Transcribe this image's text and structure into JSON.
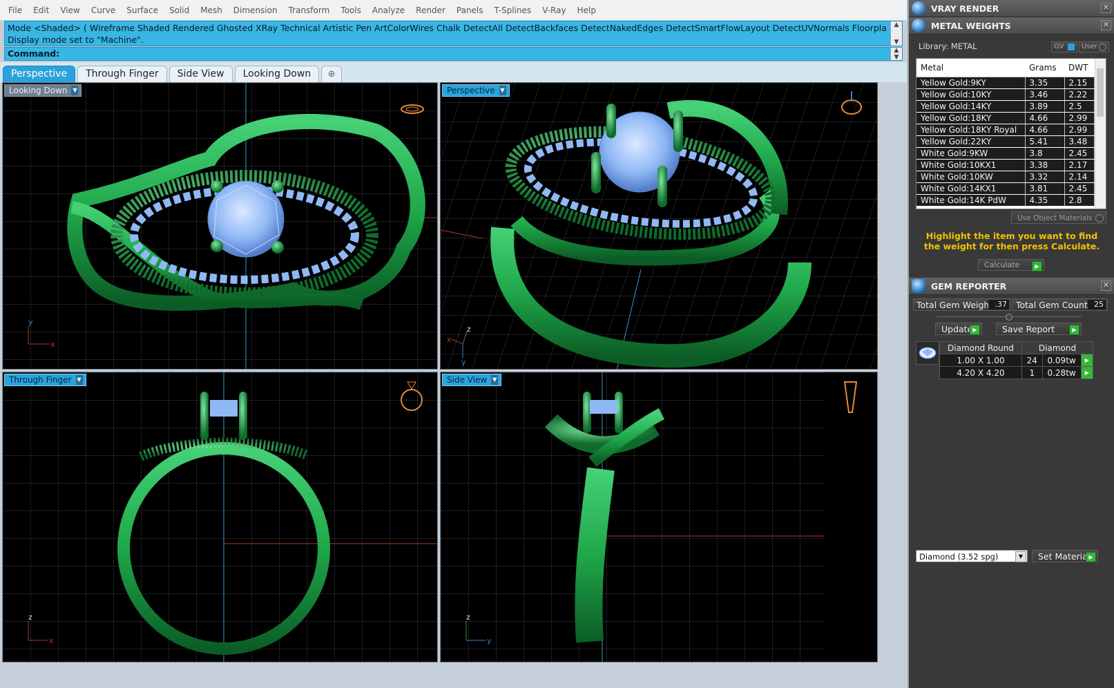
{
  "menu": [
    "File",
    "Edit",
    "View",
    "Curve",
    "Surface",
    "Solid",
    "Mesh",
    "Dimension",
    "Transform",
    "Tools",
    "Analyze",
    "Render",
    "Panels",
    "T-Splines",
    "V-Ray",
    "Help"
  ],
  "command": {
    "history_line1": "Mode <Shaded> ( Wireframe  Shaded  Rendered  Ghosted  XRay  Technical  Artistic  Pen  ArtColorWires  Chalk  DetectAll  DetectBackfaces  DetectNakedEdges  DetectSmartFlowLayout  DetectUVNormals  Floorplan  GV",
    "history_line2": "Display mode set to \"Machine\".",
    "prompt": "Command:"
  },
  "tabs": [
    {
      "label": "Perspective",
      "active": true
    },
    {
      "label": "Through Finger",
      "active": false
    },
    {
      "label": "Side View",
      "active": false
    },
    {
      "label": "Looking Down",
      "active": false
    }
  ],
  "tab_add_symbol": "⊕",
  "viewports": {
    "top_left": {
      "label": "Looking Down",
      "axes": [
        "y",
        "x"
      ]
    },
    "top_right": {
      "label": "Perspective",
      "axes": [
        "z",
        "x",
        "y"
      ]
    },
    "bottom_left": {
      "label": "Through Finger",
      "axes": [
        "z",
        "x"
      ]
    },
    "bottom_right": {
      "label": "Side View",
      "axes": [
        "z",
        "y"
      ]
    }
  },
  "colors": {
    "metal": "#1fa74a",
    "gem": "#8fb8f5",
    "grid": "#3a3a3a",
    "accent": "#2aa3dc",
    "go_button": "#35b63c",
    "calc_hint": "#f2c200"
  },
  "right_panel": {
    "vray_title": "VRAY RENDER",
    "metal_title": "METAL WEIGHTS",
    "library_label": "Library: METAL",
    "gv_label": "GV",
    "user_label": "User",
    "table_headers": [
      "Metal",
      "Grams",
      "DWT"
    ],
    "metals": [
      {
        "name": "Yellow Gold:9KY",
        "grams": "3.35",
        "dwt": "2.15"
      },
      {
        "name": "Yellow Gold:10KY",
        "grams": "3.46",
        "dwt": "2.22"
      },
      {
        "name": "Yellow Gold:14KY",
        "grams": "3.89",
        "dwt": "2.5"
      },
      {
        "name": "Yellow Gold:18KY",
        "grams": "4.66",
        "dwt": "2.99"
      },
      {
        "name": "Yellow Gold:18KY Royal",
        "grams": "4.66",
        "dwt": "2.99"
      },
      {
        "name": "Yellow Gold:22KY",
        "grams": "5.41",
        "dwt": "3.48"
      },
      {
        "name": "White Gold:9KW",
        "grams": "3.8",
        "dwt": "2.45"
      },
      {
        "name": "White Gold:10KX1",
        "grams": "3.38",
        "dwt": "2.17"
      },
      {
        "name": "White Gold:10KW",
        "grams": "3.32",
        "dwt": "2.14"
      },
      {
        "name": "White Gold:14KX1",
        "grams": "3.81",
        "dwt": "2.45"
      },
      {
        "name": "White Gold:14K PdW",
        "grams": "4.35",
        "dwt": "2.8"
      }
    ],
    "use_object_materials": "Use Object Materials",
    "calc_hint": "Highlight the item you want to find the weight for then press Calculate.",
    "calculate_label": "Calculate",
    "gem_title": "GEM REPORTER",
    "total_gem_weight_label": "Total Gem Weight",
    "total_gem_weight": ".37",
    "total_gem_count_label": "Total Gem Count",
    "total_gem_count": "25",
    "update_label": "Update",
    "save_report_label": "Save Report",
    "gem_headers": [
      "Diamond Round",
      "Diamond"
    ],
    "gems": [
      {
        "size": "1.00 X 1.00",
        "count": "24",
        "weight": "0.09tw"
      },
      {
        "size": "4.20 X 4.20",
        "count": "1",
        "weight": "0.28tw"
      }
    ],
    "material_select": "Diamond     (3.52 spg)",
    "set_material_label": "Set Material"
  }
}
